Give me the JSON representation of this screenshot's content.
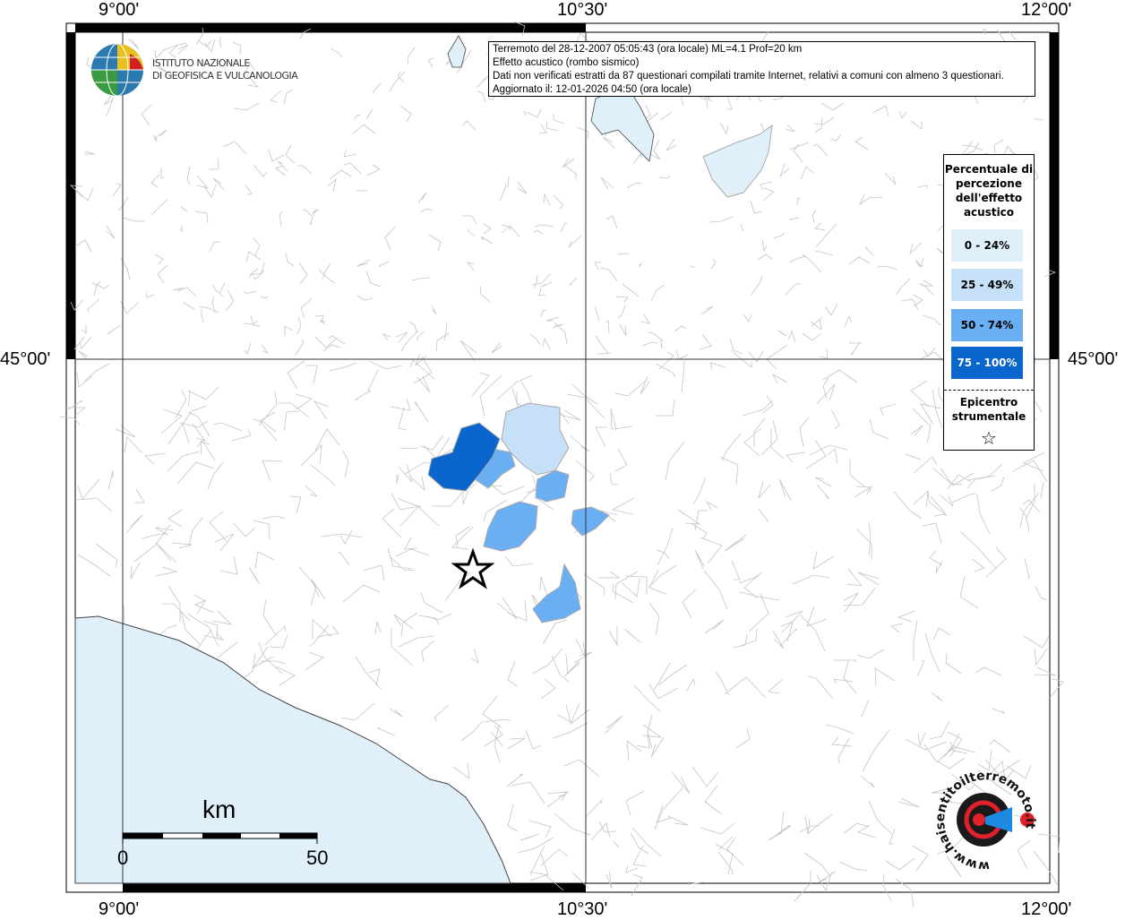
{
  "axes": {
    "top_lon": [
      "9°00'",
      "10°30'",
      "12°00'"
    ],
    "bottom_lon": [
      "9°00'",
      "10°30'",
      "12°00'"
    ],
    "left_lat": "45°00'",
    "right_lat": "45°00'"
  },
  "institute": {
    "line1": "ISTITUTO NAZIONALE",
    "line2": "DI GEOFISICA E VULCANOLOGIA"
  },
  "info": {
    "line1": "Terremoto del 28-12-2007 05:05:43 (ora locale) ML=4.1 Prof=20 km",
    "line2": "Effetto acustico (rombo sismico)",
    "line3": "Dati non verificati estratti da 87 questionari compilati tramite Internet, relativi a comuni con almeno 3 questionari.",
    "line4": "Aggiornato il: 12-01-2026 04:50 (ora locale)"
  },
  "legend": {
    "title": "Percentuale di percezione dell'effetto acustico",
    "classes": [
      {
        "label": "0 - 24%",
        "color": "#e0f0fb"
      },
      {
        "label": "25 - 49%",
        "color": "#c6e0f8"
      },
      {
        "label": "50 - 74%",
        "color": "#6aaef3"
      },
      {
        "label": "75 - 100%",
        "color": "#0a66cc"
      }
    ],
    "epicenter_label": "Epicentro strumentale",
    "epicenter_symbol": "☆"
  },
  "scale": {
    "unit": "km",
    "start": "0",
    "end": "50"
  },
  "site_logo": {
    "text": "www.haisentitoilterremoto.it"
  },
  "colors": {
    "sea": "#e0f0fb",
    "border": "#b0b0b0"
  }
}
